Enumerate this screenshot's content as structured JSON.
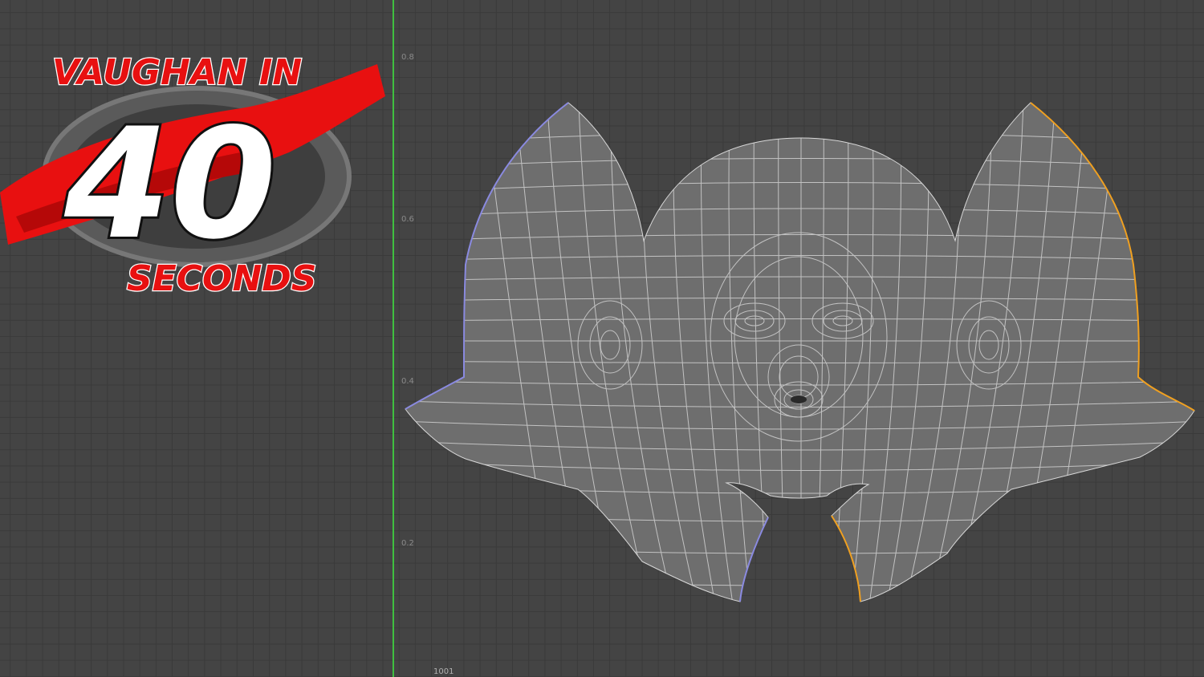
{
  "editor": {
    "axis_ticks": [
      "0.8",
      "0.6",
      "0.4",
      "0.2"
    ],
    "tile_label": "1001"
  },
  "logo": {
    "line1": "VAUGHAN IN",
    "number": "40",
    "line2": "SECONDS"
  },
  "colors": {
    "background": "#444444",
    "grid": "#3a3a3a",
    "axis": "#3fbf3f",
    "uv_fill": "#6e6e6e",
    "uv_wire": "#d8d8d8",
    "seam_left": "#8a8ae0",
    "seam_right": "#f0a020",
    "logo_red": "#e81010"
  }
}
